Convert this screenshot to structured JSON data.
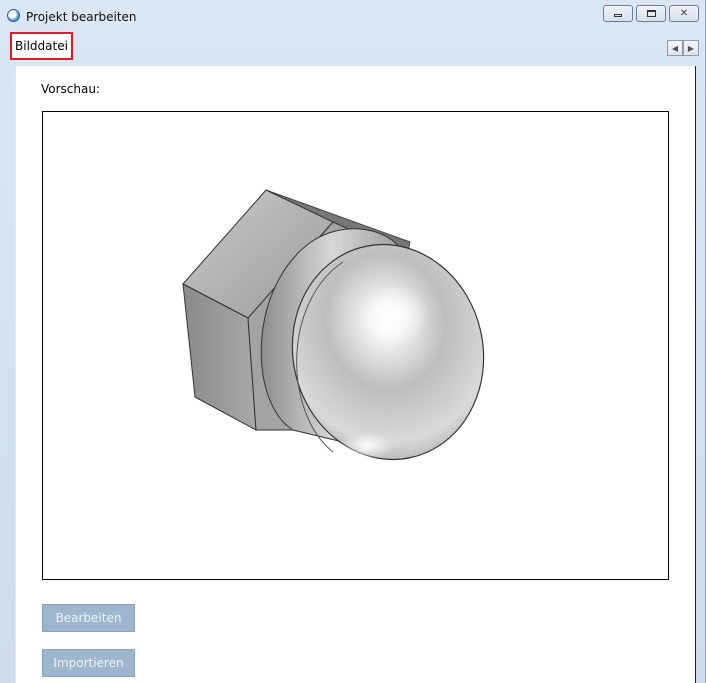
{
  "window": {
    "title": "Projekt bearbeiten",
    "controls": {
      "minimize_icon": "minimize-icon",
      "maximize_icon": "maximize-icon",
      "close_icon": "close-icon",
      "close_glyph": "✕"
    }
  },
  "tabs": [
    {
      "label": "Bilddatei",
      "active": true,
      "highlight_color": "#e8161d"
    }
  ],
  "tab_scroll": {
    "left_glyph": "◀",
    "right_glyph": "▶"
  },
  "preview": {
    "label": "Vorschau:",
    "image_icon": "cap-nut-image"
  },
  "buttons": {
    "edit_label": "Bearbeiten",
    "import_label": "Importieren"
  },
  "colors": {
    "accent_tab_border": "#e8161d",
    "disabled_button_bg": "#9db6cd",
    "window_bg": "#dbe6f4"
  }
}
